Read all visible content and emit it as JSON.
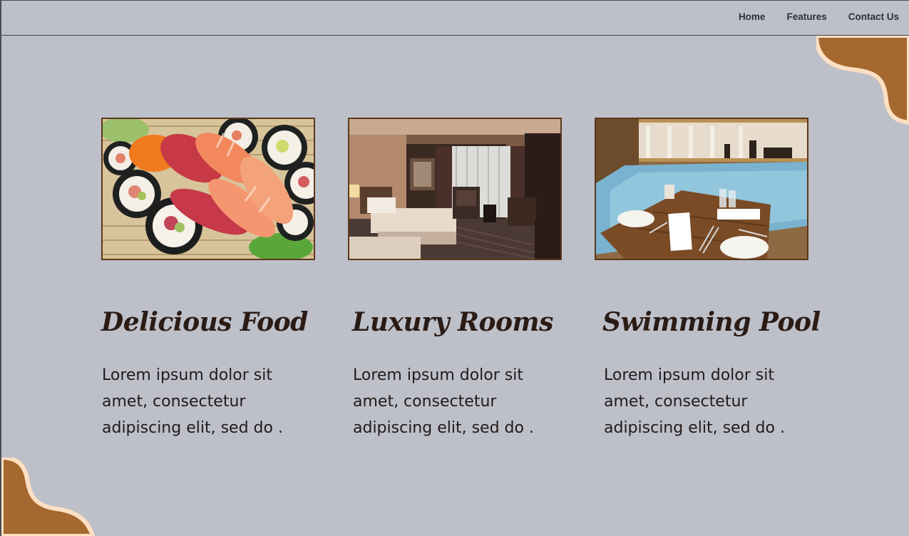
{
  "nav": {
    "links": [
      "Home",
      "Features",
      "Contact Us"
    ]
  },
  "colors": {
    "background": "#bdc0c9",
    "nav_text": "#283141",
    "blob_fill": "#a5682f",
    "blob_outline": "#fde0c2",
    "image_border": "#5b371c",
    "title_text": "#2b1b15"
  },
  "cards": [
    {
      "image": "sushi-platter-photo",
      "title": "Delicious Food",
      "text": "Lorem ipsum dolor sit amet, consectetur adipiscing elit, sed do ."
    },
    {
      "image": "hotel-room-photo",
      "title": "Luxury Rooms",
      "text": "Lorem ipsum dolor sit amet, consectetur adipiscing elit, sed do ."
    },
    {
      "image": "pool-dining-photo",
      "title": "Swimming Pool",
      "text": "Lorem ipsum dolor sit amet, consectetur adipiscing elit, sed do ."
    }
  ]
}
